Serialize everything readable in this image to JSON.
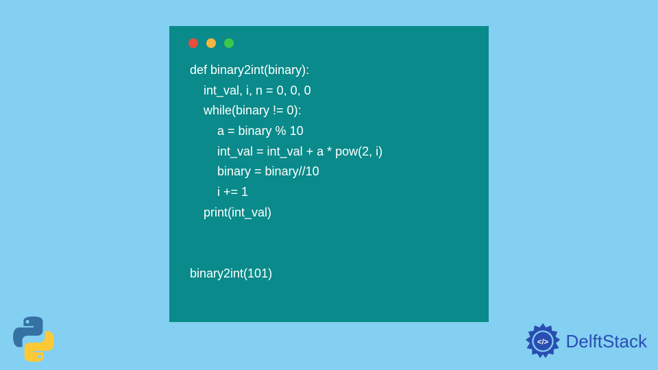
{
  "code": {
    "lines": [
      "def binary2int(binary):",
      "    int_val, i, n = 0, 0, 0",
      "    while(binary != 0):",
      "        a = binary % 10",
      "        int_val = int_val + a * pow(2, i)",
      "        binary = binary//10",
      "        i += 1",
      "    print(int_val)",
      "",
      "",
      "binary2int(101)"
    ]
  },
  "branding": {
    "name": "DelftStack"
  },
  "icons": {
    "python": "python-logo",
    "delft": "delft-gear-icon"
  },
  "dots": {
    "red": "#e94b3c",
    "yellow": "#f4b63f",
    "green": "#3cc84a"
  }
}
